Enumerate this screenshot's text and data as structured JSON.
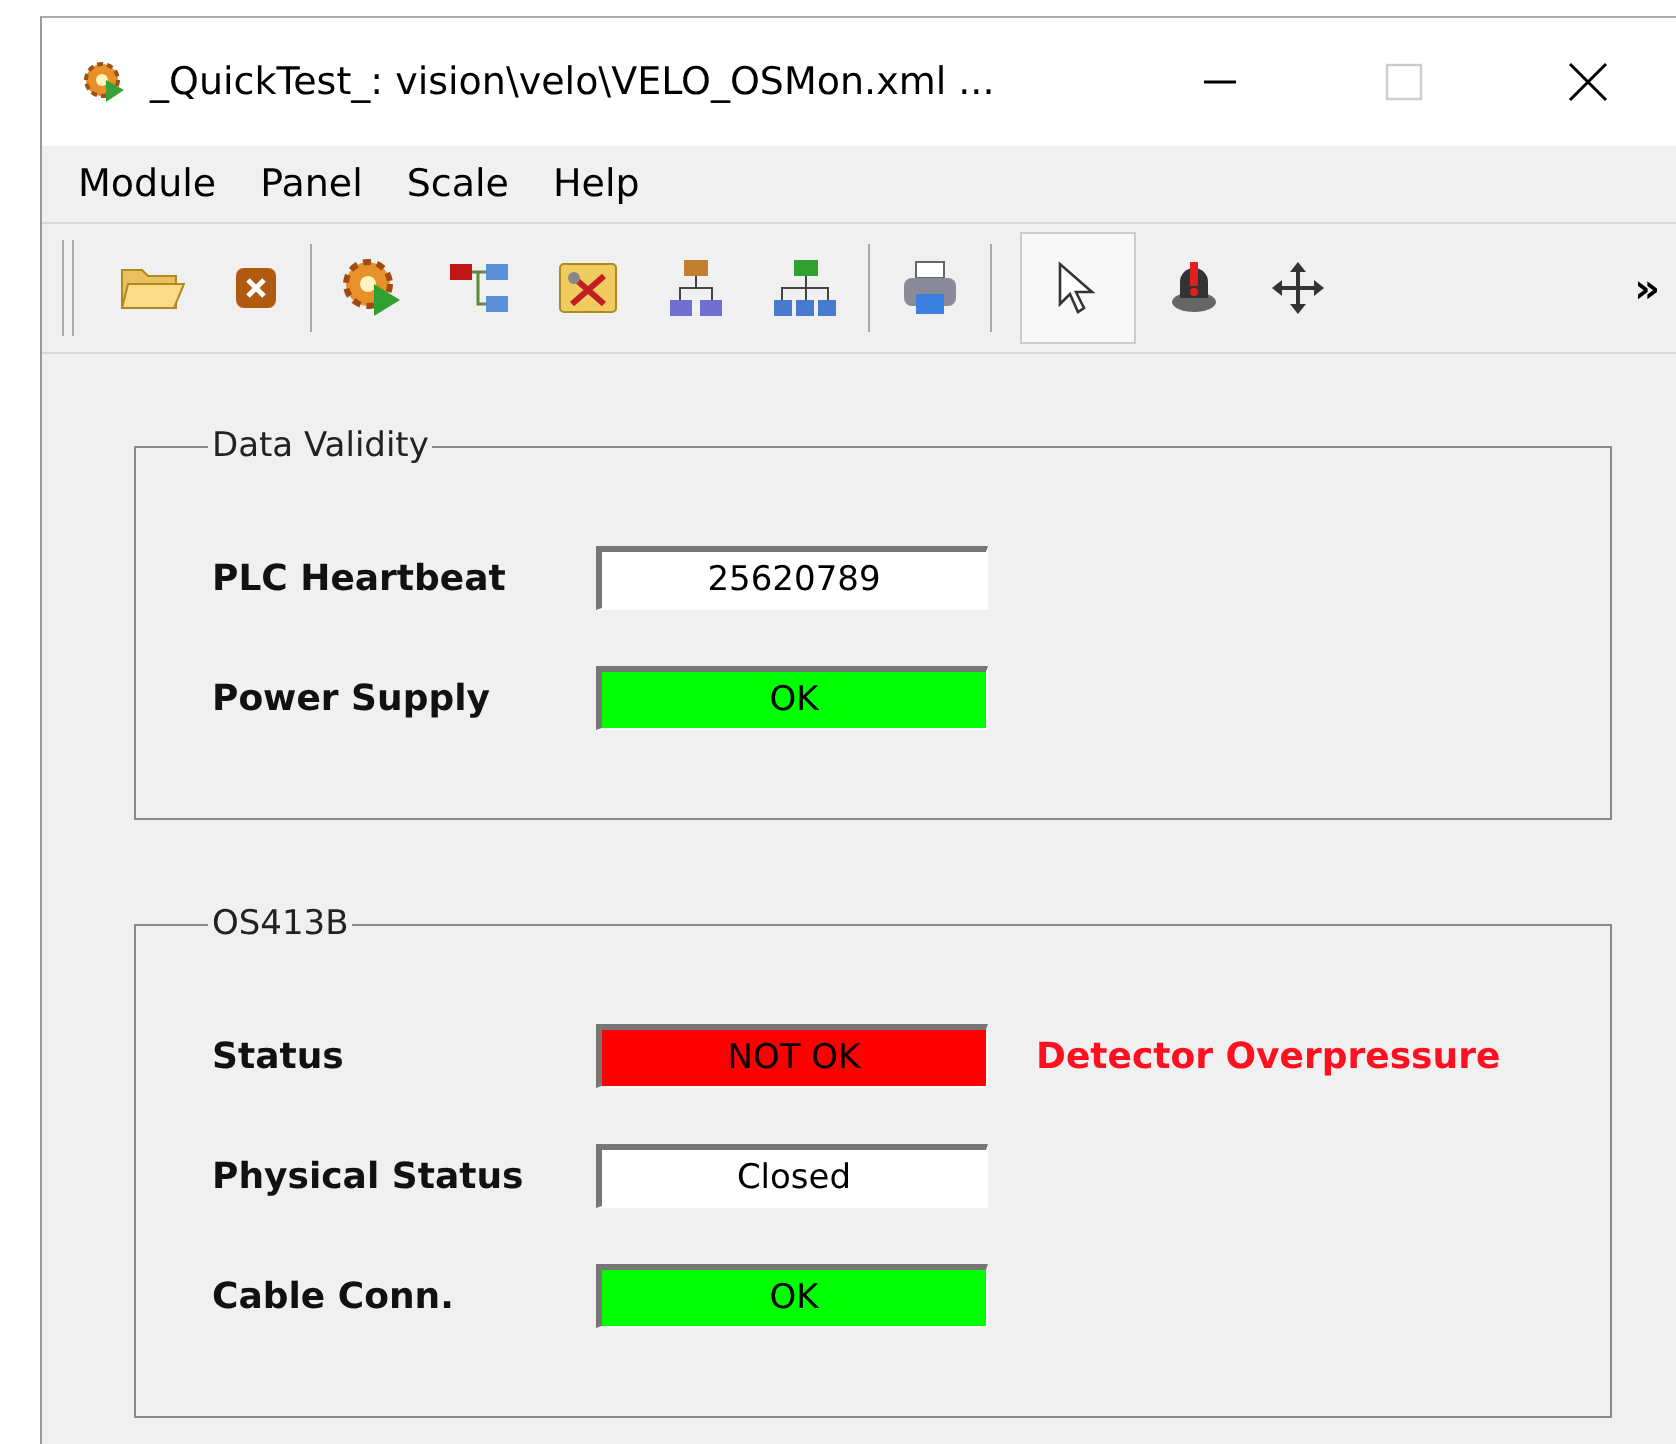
{
  "window": {
    "title": "_QuickTest_: vision\\velo\\VELO_OSMon.xml ..."
  },
  "menu": [
    "Module",
    "Panel",
    "Scale",
    "Help"
  ],
  "toolbar": {
    "overflow": "»"
  },
  "groups": [
    {
      "title": "Data Validity",
      "rows": [
        {
          "label": "PLC Heartbeat",
          "value": "25620789",
          "color": "#ffffff"
        },
        {
          "label": "Power Supply",
          "value": "OK",
          "color": "#00ff00"
        }
      ]
    },
    {
      "title": "OS413B",
      "rows": [
        {
          "label": "Status",
          "value": "NOT OK",
          "color": "#ff0000",
          "message": "Detector Overpressure"
        },
        {
          "label": "Physical Status",
          "value": "Closed",
          "color": "#ffffff"
        },
        {
          "label": "Cable Conn.",
          "value": "OK",
          "color": "#00ff00"
        }
      ]
    }
  ]
}
